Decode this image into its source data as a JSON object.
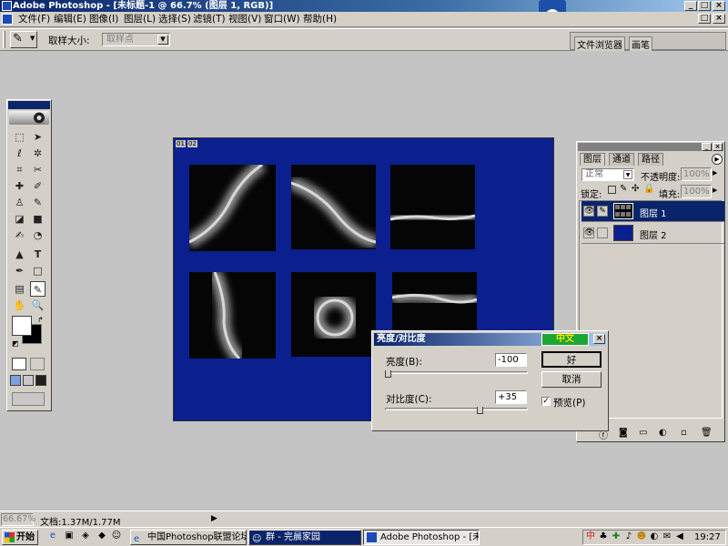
{
  "window": {
    "title": "Adobe Photoshop - [未标题-1 @ 66.7% (图层 1, RGB)]"
  },
  "menu": [
    "文件(F)",
    "编辑(E)",
    "图像(I)",
    "图层(L)",
    "选择(S)",
    "滤镜(T)",
    "视图(V)",
    "窗口(W)",
    "帮助(H)"
  ],
  "options_bar": {
    "sample_size_label": "取样大小:",
    "sample_size_value": "取样点",
    "palette_well_tabs": [
      "文件浏览器",
      "画笔"
    ]
  },
  "document": {
    "tab_labels": [
      "01",
      "02"
    ]
  },
  "layers_palette": {
    "tabs": [
      "图层",
      "通道",
      "路径"
    ],
    "blend_mode": "正常",
    "opacity_label": "不透明度:",
    "opacity_value": "100%",
    "lock_label": "锁定:",
    "fill_label": "填充:",
    "fill_value": "100%",
    "layers": [
      {
        "name": "图层 1",
        "selected": true
      },
      {
        "name": "图层 2",
        "selected": false
      }
    ]
  },
  "dialog": {
    "title": "亮度/对比度",
    "ime_label": "中文",
    "brightness_label": "亮度(B):",
    "brightness_value": "-100",
    "brightness_fraction": 0.0,
    "contrast_label": "对比度(C):",
    "contrast_value": "+35",
    "contrast_fraction": 0.675,
    "ok_label": "好",
    "cancel_label": "取消",
    "preview_label": "预览(P)",
    "preview_checked": true
  },
  "status": {
    "zoom": "66.67%",
    "doc_info": "文档:1.37M/1.77M"
  },
  "taskbar": {
    "start_label": "开始",
    "tasks": [
      {
        "label": "中国Photoshop联盟论坛...",
        "active": false
      },
      {
        "label": "群 - 完晨家园",
        "active": false
      },
      {
        "label": "Adobe Photoshop - [未标...",
        "active": true
      }
    ],
    "clock": "19:27"
  },
  "colors": {
    "canvas_blue": "#0c1f8e",
    "titlebar": "#0a246a",
    "selection": "#0a246a"
  }
}
